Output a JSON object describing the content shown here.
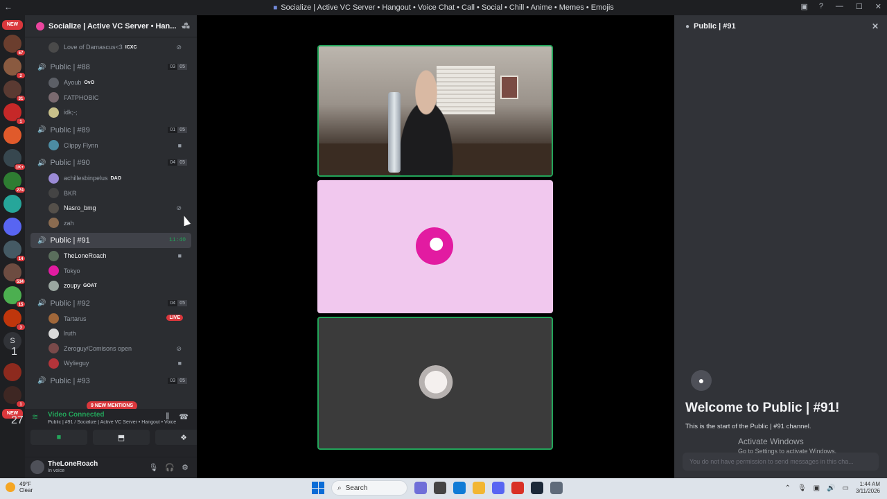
{
  "titlebar": {
    "title": "Socialize | Active VC Server • Hangout • Voice Chat • Call • Social • Chill • Anime • Memes • Emojis",
    "back_icon": "arrow-left-icon"
  },
  "servers": {
    "items": [
      {
        "kind": "new",
        "label": "NEW"
      },
      {
        "kind": "icon",
        "color": "#6b3e2e",
        "badge": "57"
      },
      {
        "kind": "icon",
        "color": "#8a5a40",
        "badge": "2"
      },
      {
        "kind": "icon",
        "color": "#5a3a32",
        "badge": "31"
      },
      {
        "kind": "icon",
        "color": "#c62828",
        "badge": "1"
      },
      {
        "kind": "icon",
        "color": "#e05a2b",
        "badge": ""
      },
      {
        "kind": "icon",
        "color": "#37474f",
        "badge": "1K+"
      },
      {
        "kind": "icon",
        "color": "#2e7d32",
        "badge": "274"
      },
      {
        "kind": "icon",
        "color": "#26a69a",
        "badge": ""
      },
      {
        "kind": "icon",
        "color": "#5865f2",
        "badge": ""
      },
      {
        "kind": "icon",
        "color": "#455a64",
        "badge": "14"
      },
      {
        "kind": "icon",
        "color": "#6d4c41",
        "badge": "534"
      },
      {
        "kind": "icon",
        "color": "#4caf50",
        "badge": "15"
      },
      {
        "kind": "icon",
        "color": "#bf360c",
        "badge": "3"
      },
      {
        "kind": "letter",
        "label": "S",
        "badge": "1"
      },
      {
        "kind": "icon",
        "color": "#8d2a1e",
        "badge": ""
      },
      {
        "kind": "icon",
        "color": "#3e2723",
        "badge": "1"
      },
      {
        "kind": "new",
        "label": "NEW",
        "badge": "27"
      }
    ]
  },
  "guild": {
    "name": "Socialize | Active VC Server • Han...",
    "chevron_icon": "chevron-down-icon",
    "invite_icon": "add-member-icon"
  },
  "channels": [
    {
      "name": "Public | #88",
      "count": "03",
      "limit": "05",
      "users": [
        {
          "name": "Ayoub",
          "tag": "OvO",
          "color": "#5c5f66",
          "dim": true
        },
        {
          "name": "FATPHOBIC",
          "tag": "",
          "color": "#7a6a6f",
          "dim": true
        },
        {
          "name": "idk;-;",
          "tag": "",
          "color": "#c8c08a",
          "dim": true
        }
      ]
    },
    {
      "name": "Public | #89",
      "count": "01",
      "limit": "05",
      "users": [
        {
          "name": "Clippy Flynn",
          "tag": "",
          "color": "#4c8ca3",
          "dim": true,
          "icon": "camera-icon"
        }
      ]
    },
    {
      "name": "Public | #90",
      "count": "04",
      "limit": "05",
      "users": [
        {
          "name": "achillesbinpelus",
          "tag": "DAO",
          "color": "#9b8bd6",
          "dim": true
        },
        {
          "name": "BKR",
          "tag": "",
          "color": "#444",
          "dim": true
        },
        {
          "name": "Nasro_bmg",
          "tag": "",
          "color": "#55504a",
          "dim": false,
          "icon": "deafened-icon"
        },
        {
          "name": "zah",
          "tag": "",
          "color": "#8a6b50",
          "dim": true
        }
      ]
    },
    {
      "name": "Public | #91",
      "timer": "11:40",
      "active": true,
      "users": [
        {
          "name": "TheLoneRoach",
          "tag": "",
          "color": "#5a6e5c",
          "dim": false,
          "icon": "camera-icon"
        },
        {
          "name": "Tokyo",
          "tag": "",
          "color": "#e21ba1",
          "dim": true
        },
        {
          "name": "zoupy",
          "tag": "GOAT",
          "color": "#9aa6a0",
          "dim": false
        }
      ]
    },
    {
      "name": "Public | #92",
      "count": "04",
      "limit": "05",
      "users": [
        {
          "name": "Tartarus",
          "tag": "",
          "color": "#a0673a",
          "dim": true,
          "live": "LIVE"
        },
        {
          "name": "lruth",
          "tag": "",
          "color": "#d9d9d9",
          "dim": true
        },
        {
          "name": "Zeroguy/Comisons open",
          "tag": "",
          "color": "#7a4a4a",
          "dim": true,
          "icon": "deafened-icon"
        },
        {
          "name": "Wylieguy",
          "tag": "",
          "color": "#b3343a",
          "dim": true,
          "icon": "camera-icon"
        }
      ]
    },
    {
      "name": "Public | #93",
      "count": "03",
      "limit": "05",
      "users": []
    }
  ],
  "top_user": {
    "name": "Love of Damascus<3",
    "tag": "ICXC",
    "icon": "deafened-icon"
  },
  "mentions_pill": "9 NEW MENTIONS",
  "voice": {
    "status": "Video Connected",
    "subtitle": "Public | #91 / Socialize | Active VC Server • Hangout • Voice",
    "buttons": [
      "camera-icon",
      "screen-share-icon",
      "activities-icon"
    ]
  },
  "user": {
    "name": "TheLoneRoach",
    "status": "In voice"
  },
  "sidepanel": {
    "title": "Public | #91",
    "welcome": "Welcome to Public | #91!",
    "start_text": "This is the start of the Public | #91 channel.",
    "no_permission": "You do not have permission to send messages in this cha..."
  },
  "watermark": {
    "line1": "Activate Windows",
    "line2": "Go to Settings to activate Windows."
  },
  "taskbar": {
    "temp": "49°F",
    "cond": "Clear",
    "search": "Search",
    "time": "1:44 AM",
    "date": "3/11/2026",
    "apps": [
      "#6f6fd8",
      "#444",
      "#0f7bd6",
      "#f2b632",
      "#5865f2",
      "#d93025",
      "#1b2838",
      "#5f6b7a"
    ]
  },
  "colors": {
    "accent_green": "#23a55a",
    "badge_red": "#da373c",
    "bg_dark": "#2b2d31"
  }
}
